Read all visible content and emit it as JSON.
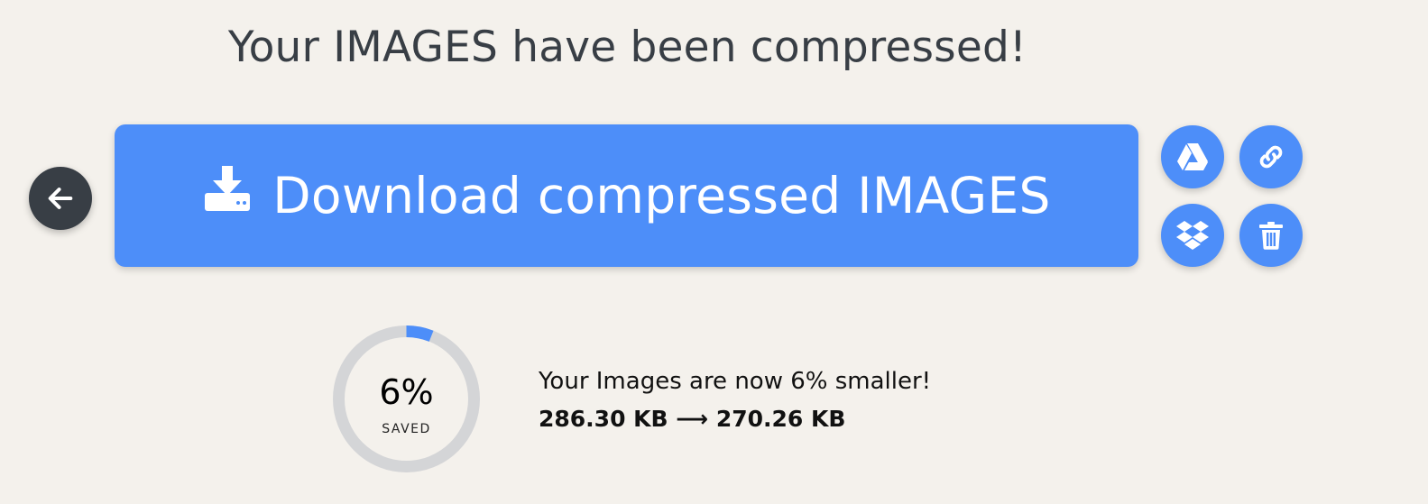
{
  "page": {
    "title": "Your IMAGES have been compressed!"
  },
  "actions": {
    "download_label": "Download compressed IMAGES",
    "back_icon": "arrow-left-icon",
    "download_icon": "download-tray-icon",
    "side_buttons": [
      {
        "name": "google-drive",
        "icon": "google-drive-icon"
      },
      {
        "name": "copy-link",
        "icon": "link-icon"
      },
      {
        "name": "dropbox",
        "icon": "dropbox-icon"
      },
      {
        "name": "delete",
        "icon": "trash-icon"
      }
    ]
  },
  "result": {
    "percent_saved": 6,
    "percent_label": "6%",
    "saved_label": "SAVED",
    "summary": "Your Images are now 6% smaller!",
    "sizes": "286.30 KB ⟶ 270.26 KB"
  },
  "colors": {
    "background": "#f4f1ec",
    "accent": "#4d8ef9",
    "dark": "#383e45",
    "ring_track": "#d4d5d7"
  }
}
